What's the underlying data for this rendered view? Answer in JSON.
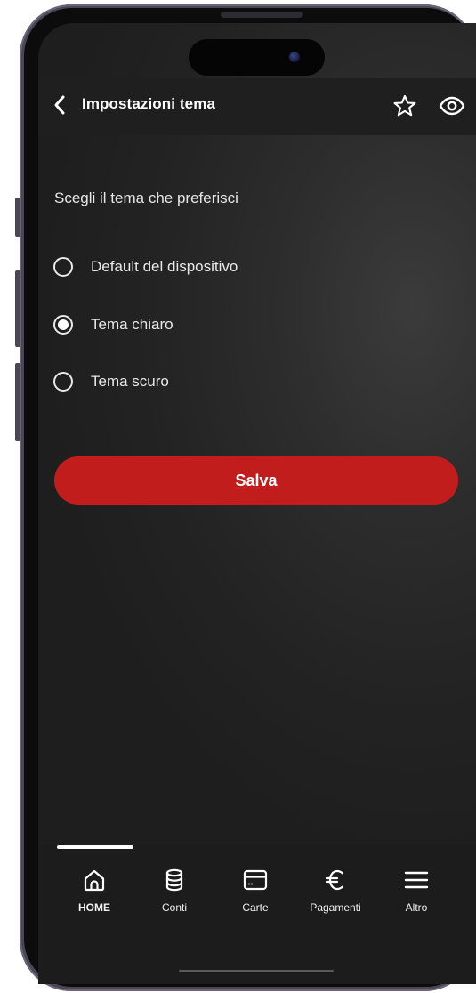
{
  "header": {
    "title": "Impostazioni tema"
  },
  "theme": {
    "prompt": "Scegli il tema che preferisci",
    "options": [
      {
        "label": "Default del dispositivo",
        "selected": false
      },
      {
        "label": "Tema chiaro",
        "selected": true
      },
      {
        "label": "Tema scuro",
        "selected": false
      }
    ],
    "save_label": "Salva"
  },
  "nav": {
    "items": [
      {
        "label": "HOME",
        "icon": "home-icon",
        "active": true
      },
      {
        "label": "Conti",
        "icon": "database-icon",
        "active": false
      },
      {
        "label": "Carte",
        "icon": "card-icon",
        "active": false
      },
      {
        "label": "Pagamenti",
        "icon": "euro-icon",
        "active": false
      },
      {
        "label": "Altro",
        "icon": "menu-icon",
        "active": false
      }
    ]
  },
  "colors": {
    "accent": "#c21d1d",
    "background": "#2d2d2d",
    "header": "#1f1f1f",
    "nav": "#1c1c1c"
  }
}
